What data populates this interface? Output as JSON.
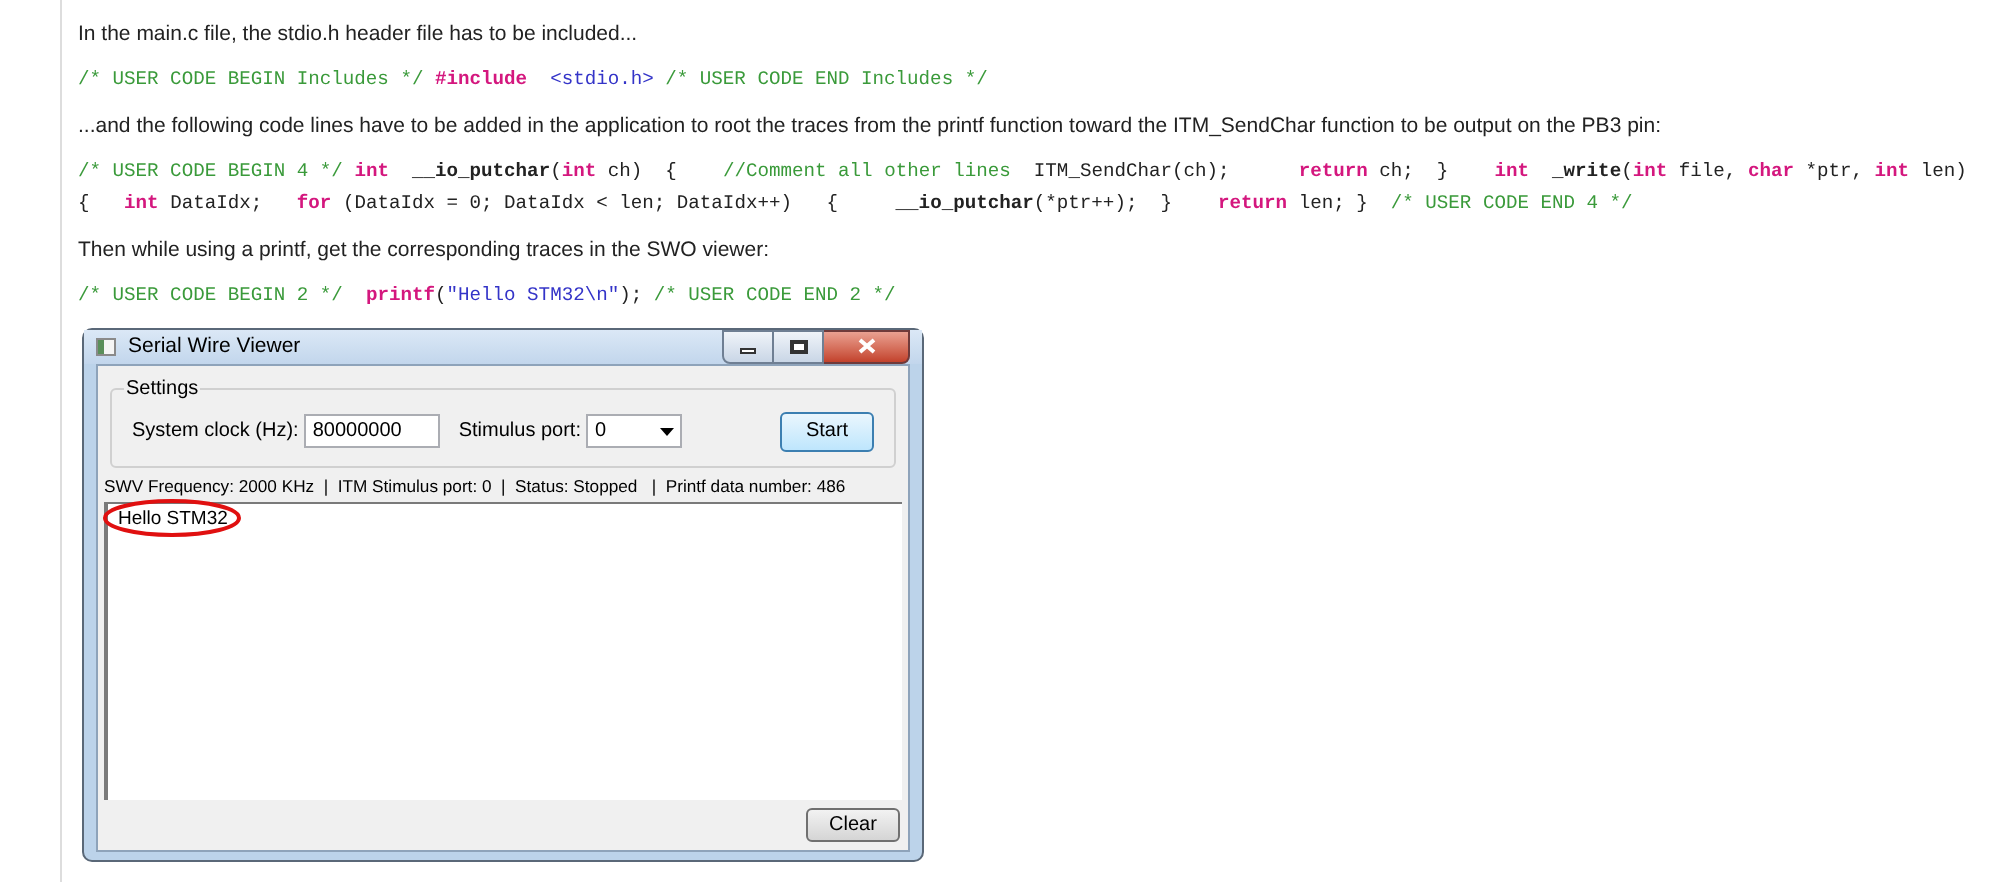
{
  "blocks": [
    {
      "kind": "text",
      "text": "In the main.c file, the stdio.h header file has to be included..."
    },
    {
      "kind": "code",
      "lines": [
        [
          {
            "kind": "comment",
            "text": "/* USER CODE BEGIN Includes */ "
          },
          {
            "kind": "keyword",
            "text": "#include  "
          },
          {
            "kind": "string",
            "text": "<stdio.h> "
          },
          {
            "kind": "comment",
            "text": "/* USER CODE END Includes */"
          }
        ]
      ]
    },
    {
      "kind": "text",
      "text": "...and the following code lines have to be added in the application to root the traces from the printf function toward the ITM_SendChar function to be output on the PB3 pin:"
    },
    {
      "kind": "code",
      "lines": [
        [
          {
            "kind": "comment",
            "text": "/* USER CODE BEGIN 4 */ "
          },
          {
            "kind": "keyword",
            "text": "int  "
          },
          {
            "kind": "function",
            "text": "__io_putchar"
          },
          {
            "kind": "plain",
            "text": "("
          },
          {
            "kind": "keyword",
            "text": "int"
          },
          {
            "kind": "plain",
            "text": " ch)  {    "
          },
          {
            "kind": "comment",
            "text": "//Comment all other lines"
          },
          {
            "kind": "plain",
            "text": "  ITM_SendChar(ch);      "
          },
          {
            "kind": "keyword",
            "text": "return"
          },
          {
            "kind": "plain",
            "text": " ch;  }    "
          },
          {
            "kind": "keyword",
            "text": "int  "
          },
          {
            "kind": "function",
            "text": "_write"
          },
          {
            "kind": "plain",
            "text": "("
          },
          {
            "kind": "keyword",
            "text": "int"
          },
          {
            "kind": "plain",
            "text": " file, "
          },
          {
            "kind": "keyword",
            "text": "char"
          },
          {
            "kind": "plain",
            "text": " *ptr, "
          },
          {
            "kind": "keyword",
            "text": "int"
          },
          {
            "kind": "plain",
            "text": " len)"
          }
        ],
        [
          {
            "kind": "plain",
            "text": "{   "
          },
          {
            "kind": "keyword",
            "text": "int"
          },
          {
            "kind": "plain",
            "text": " DataIdx;   "
          },
          {
            "kind": "keyword",
            "text": "for"
          },
          {
            "kind": "plain",
            "text": " (DataIdx = 0; DataIdx < len; DataIdx++)   {     "
          },
          {
            "kind": "function",
            "text": "__io_putchar"
          },
          {
            "kind": "plain",
            "text": "(*ptr++);  }    "
          },
          {
            "kind": "keyword",
            "text": "return"
          },
          {
            "kind": "plain",
            "text": " len; }  "
          },
          {
            "kind": "comment",
            "text": "/* USER CODE END 4 */"
          }
        ]
      ]
    },
    {
      "kind": "text",
      "text": "Then while using a printf, get the corresponding traces in the SWO viewer:"
    },
    {
      "kind": "code",
      "lines": [
        [
          {
            "kind": "comment",
            "text": "/* USER CODE BEGIN 2 */  "
          },
          {
            "kind": "keyword",
            "text": "printf"
          },
          {
            "kind": "plain",
            "text": "("
          },
          {
            "kind": "string",
            "text": "\"Hello STM32\\n\""
          },
          {
            "kind": "plain",
            "text": "); "
          },
          {
            "kind": "comment",
            "text": "/* USER CODE END 2 */"
          }
        ]
      ]
    }
  ],
  "window": {
    "title": "Serial Wire Viewer",
    "settings": {
      "label": "Settings",
      "clock_label": "System clock (Hz):",
      "clock_value": "80000000",
      "port_label": "Stimulus port:",
      "port_value": "0",
      "start_button": "Start"
    },
    "status_bar": "SWV Frequency: 2000 KHz  |  ITM Stimulus port: 0  |  Status: Stopped   |  Printf data number: 486",
    "output_lines": [
      "Hello STM32"
    ],
    "clear_button": "Clear"
  }
}
